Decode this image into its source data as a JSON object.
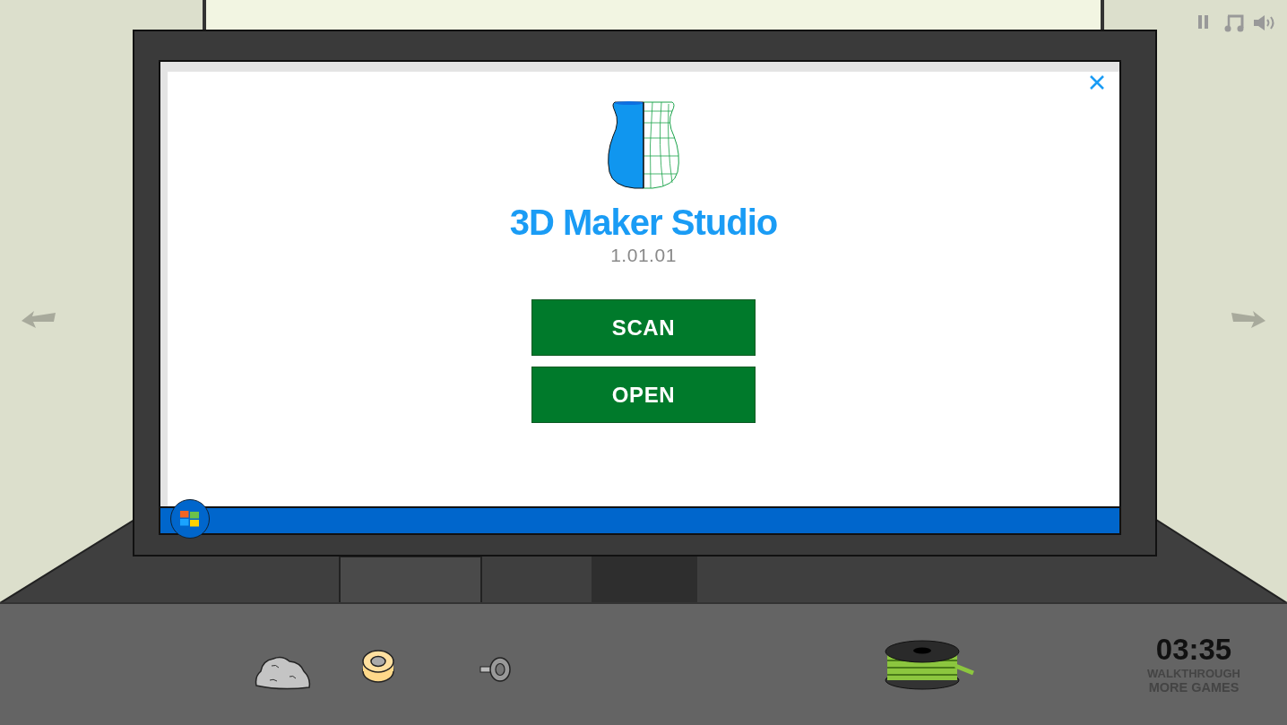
{
  "app": {
    "title": "3D Maker Studio",
    "version": "1.01.01"
  },
  "buttons": [
    {
      "label": "SCAN"
    },
    {
      "label": "OPEN"
    }
  ],
  "hud": {
    "timer": "03:35",
    "links": [
      "WALKTHROUGH",
      "MORE GAMES"
    ]
  }
}
